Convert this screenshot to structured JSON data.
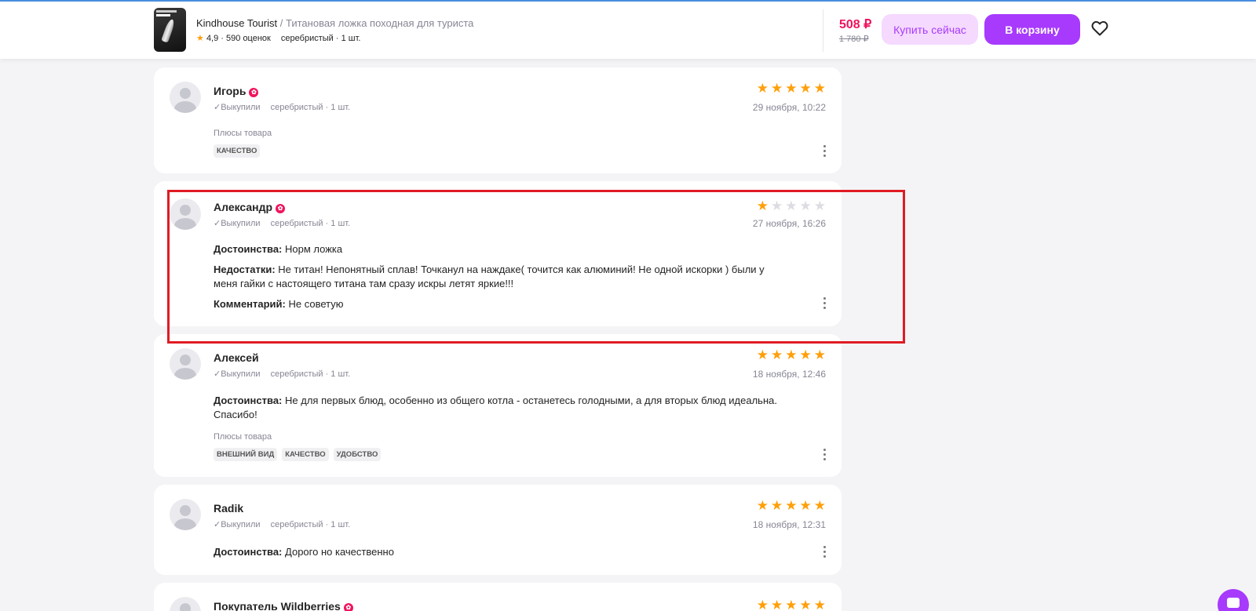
{
  "header": {
    "brand": "Kindhouse Tourist",
    "separator": "/",
    "product": "Титановая ложка походная для туриста",
    "rating": "4,9",
    "reviews_count": "590 оценок",
    "variant": "серебристый · 1 шт.",
    "price": "508 ₽",
    "old_price": "1 780 ₽",
    "buy_now_label": "Купить сейчас",
    "cart_label": "В корзину",
    "thumb_text": "ЛОЖКА"
  },
  "reviews": [
    {
      "name": "Игорь",
      "bought": "✓Выкупили",
      "variant": "серебристый · 1 шт.",
      "rating": 5,
      "date": "29 ноября, 10:22",
      "plus_title": "Плюсы товара",
      "tags": [
        "КАЧЕСТВО"
      ]
    },
    {
      "name": "Александр",
      "bought": "✓Выкупили",
      "variant": "серебристый · 1 шт.",
      "rating": 1,
      "date": "27 ноября, 16:26",
      "pros_label": "Достоинства:",
      "pros": "Норм ложка",
      "cons_label": "Недостатки:",
      "cons": "Не титан! Непонятный сплав! Точканул на наждаке( точится как алюминий! Не одной искорки ) были у меня гайки с настоящего титана там сразу искры летят яркие!!!",
      "comment_label": "Комментарий:",
      "comment": "Не советую"
    },
    {
      "name": "Алексей",
      "bought": "✓Выкупили",
      "variant": "серебристый · 1 шт.",
      "rating": 5,
      "date": "18 ноября, 12:46",
      "pros_label": "Достоинства:",
      "pros": "Не для первых блюд, особенно из общего котла - останетесь голодными, а для вторых блюд идеальна. Спасибо!",
      "plus_title": "Плюсы товара",
      "tags": [
        "ВНЕШНИЙ ВИД",
        "КАЧЕСТВО",
        "УДОБСТВО"
      ]
    },
    {
      "name": "Radik",
      "bought": "✓Выкупили",
      "variant": "серебристый · 1 шт.",
      "rating": 5,
      "date": "18 ноября, 12:31",
      "pros_label": "Достоинства:",
      "pros": "Дорого но качественно"
    },
    {
      "name": "Покупатель Wildberries",
      "rating": 5
    }
  ],
  "colors": {
    "accent": "#a73afd",
    "price": "#f0135b",
    "star": "#ff9f0a",
    "highlight": "#e01b24"
  },
  "icons": [
    "star-icon",
    "heart-icon",
    "more-icon",
    "check-icon",
    "badge-icon",
    "chat-icon",
    "avatar-icon"
  ]
}
